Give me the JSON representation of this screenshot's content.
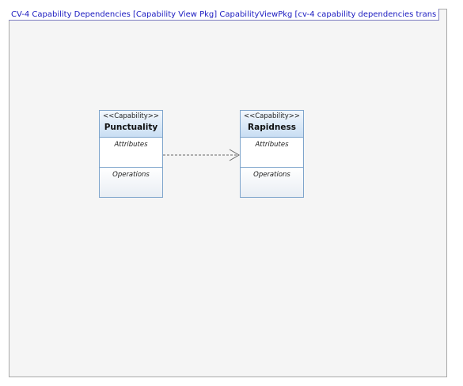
{
  "diagram": {
    "title": "CV-4 Capability Dependencies [Capability View Pkg] CapabilityViewPkg [cv-4 capability dependencies trans",
    "elements": [
      {
        "stereotype": "<<Capability>>",
        "name": "Punctuality",
        "attributes_label": "Attributes",
        "operations_label": "Operations"
      },
      {
        "stereotype": "<<Capability>>",
        "name": "Rapidness",
        "attributes_label": "Attributes",
        "operations_label": "Operations"
      }
    ],
    "relationships": [
      {
        "type": "dependency",
        "from": "Punctuality",
        "to": "Rapidness",
        "style": "dashed-open-arrow"
      }
    ]
  },
  "colors": {
    "frame_background": "#f5f5f5",
    "frame_title_text": "#1a1ac0",
    "class_border": "#7fa5cc",
    "class_header_fill": "#c9def3",
    "dependency_line": "#666666"
  }
}
